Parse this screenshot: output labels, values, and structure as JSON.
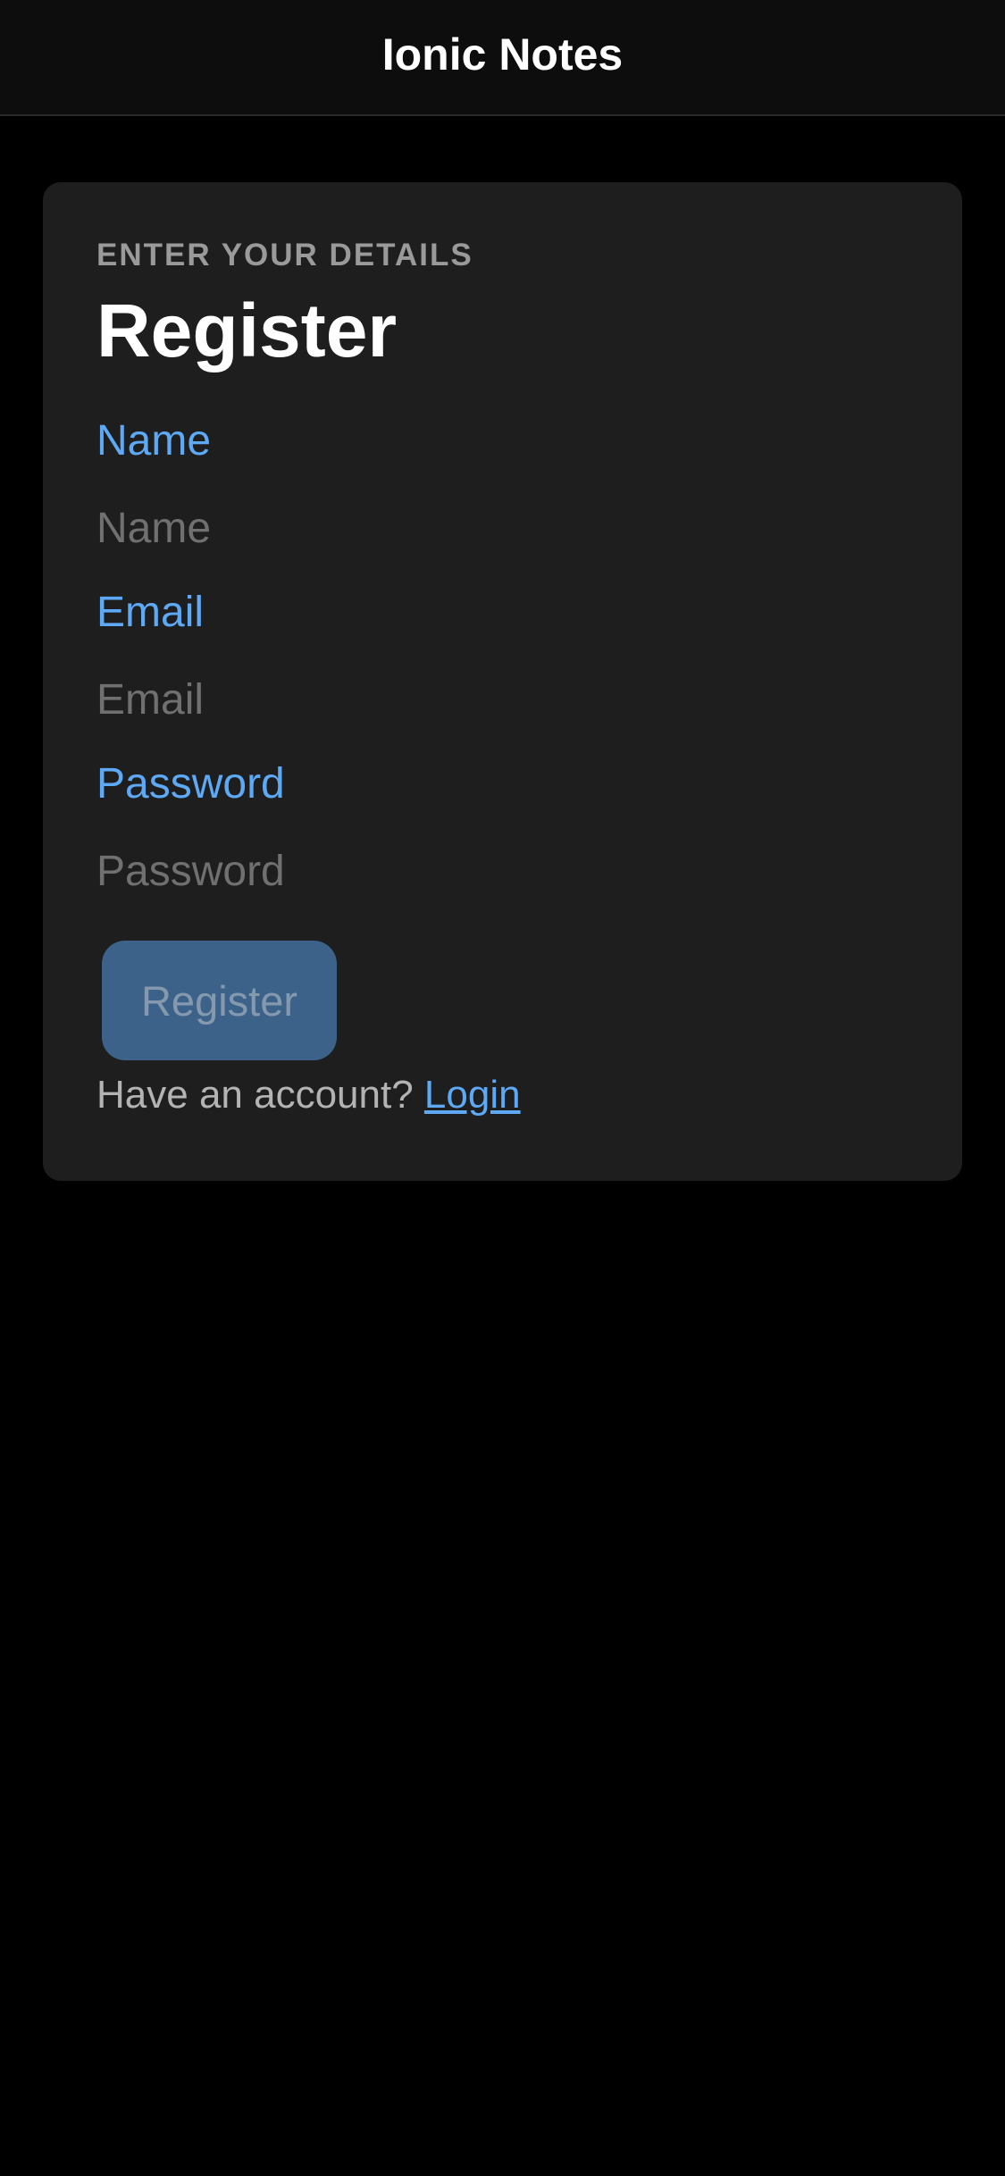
{
  "header": {
    "title": "Ionic Notes"
  },
  "card": {
    "subtitle": "ENTER YOUR DETAILS",
    "title": "Register"
  },
  "form": {
    "name": {
      "label": "Name",
      "placeholder": "Name",
      "value": ""
    },
    "email": {
      "label": "Email",
      "placeholder": "Email",
      "value": ""
    },
    "password": {
      "label": "Password",
      "placeholder": "Password",
      "value": ""
    },
    "submit_label": "Register"
  },
  "footer": {
    "prompt": "Have an account?",
    "link_label": "Login"
  },
  "colors": {
    "background": "#000000",
    "toolbar": "#0d0d0d",
    "card": "#1e1e1e",
    "accent": "#5ea9f5",
    "button": "#3f668f"
  }
}
